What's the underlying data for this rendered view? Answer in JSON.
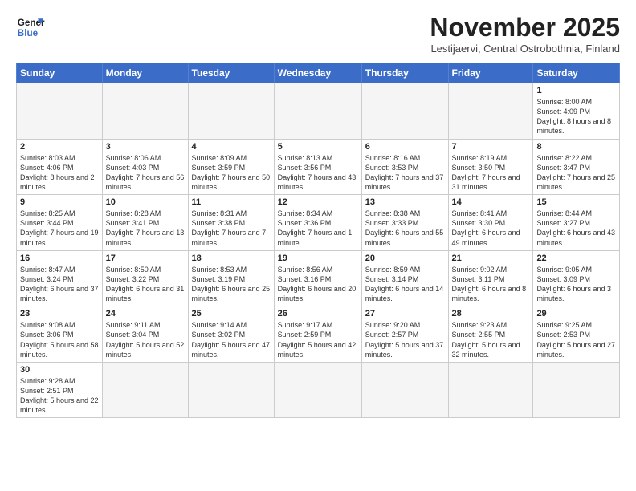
{
  "logo": {
    "line1": "General",
    "line2": "Blue"
  },
  "title": "November 2025",
  "subtitle": "Lestijaervi, Central Ostrobothnia, Finland",
  "weekdays": [
    "Sunday",
    "Monday",
    "Tuesday",
    "Wednesday",
    "Thursday",
    "Friday",
    "Saturday"
  ],
  "weeks": [
    [
      {
        "day": "",
        "info": ""
      },
      {
        "day": "",
        "info": ""
      },
      {
        "day": "",
        "info": ""
      },
      {
        "day": "",
        "info": ""
      },
      {
        "day": "",
        "info": ""
      },
      {
        "day": "",
        "info": ""
      },
      {
        "day": "1",
        "info": "Sunrise: 8:00 AM\nSunset: 4:09 PM\nDaylight: 8 hours\nand 8 minutes."
      }
    ],
    [
      {
        "day": "2",
        "info": "Sunrise: 8:03 AM\nSunset: 4:06 PM\nDaylight: 8 hours\nand 2 minutes."
      },
      {
        "day": "3",
        "info": "Sunrise: 8:06 AM\nSunset: 4:03 PM\nDaylight: 7 hours\nand 56 minutes."
      },
      {
        "day": "4",
        "info": "Sunrise: 8:09 AM\nSunset: 3:59 PM\nDaylight: 7 hours\nand 50 minutes."
      },
      {
        "day": "5",
        "info": "Sunrise: 8:13 AM\nSunset: 3:56 PM\nDaylight: 7 hours\nand 43 minutes."
      },
      {
        "day": "6",
        "info": "Sunrise: 8:16 AM\nSunset: 3:53 PM\nDaylight: 7 hours\nand 37 minutes."
      },
      {
        "day": "7",
        "info": "Sunrise: 8:19 AM\nSunset: 3:50 PM\nDaylight: 7 hours\nand 31 minutes."
      },
      {
        "day": "8",
        "info": "Sunrise: 8:22 AM\nSunset: 3:47 PM\nDaylight: 7 hours\nand 25 minutes."
      }
    ],
    [
      {
        "day": "9",
        "info": "Sunrise: 8:25 AM\nSunset: 3:44 PM\nDaylight: 7 hours\nand 19 minutes."
      },
      {
        "day": "10",
        "info": "Sunrise: 8:28 AM\nSunset: 3:41 PM\nDaylight: 7 hours\nand 13 minutes."
      },
      {
        "day": "11",
        "info": "Sunrise: 8:31 AM\nSunset: 3:38 PM\nDaylight: 7 hours\nand 7 minutes."
      },
      {
        "day": "12",
        "info": "Sunrise: 8:34 AM\nSunset: 3:36 PM\nDaylight: 7 hours\nand 1 minute."
      },
      {
        "day": "13",
        "info": "Sunrise: 8:38 AM\nSunset: 3:33 PM\nDaylight: 6 hours\nand 55 minutes."
      },
      {
        "day": "14",
        "info": "Sunrise: 8:41 AM\nSunset: 3:30 PM\nDaylight: 6 hours\nand 49 minutes."
      },
      {
        "day": "15",
        "info": "Sunrise: 8:44 AM\nSunset: 3:27 PM\nDaylight: 6 hours\nand 43 minutes."
      }
    ],
    [
      {
        "day": "16",
        "info": "Sunrise: 8:47 AM\nSunset: 3:24 PM\nDaylight: 6 hours\nand 37 minutes."
      },
      {
        "day": "17",
        "info": "Sunrise: 8:50 AM\nSunset: 3:22 PM\nDaylight: 6 hours\nand 31 minutes."
      },
      {
        "day": "18",
        "info": "Sunrise: 8:53 AM\nSunset: 3:19 PM\nDaylight: 6 hours\nand 25 minutes."
      },
      {
        "day": "19",
        "info": "Sunrise: 8:56 AM\nSunset: 3:16 PM\nDaylight: 6 hours\nand 20 minutes."
      },
      {
        "day": "20",
        "info": "Sunrise: 8:59 AM\nSunset: 3:14 PM\nDaylight: 6 hours\nand 14 minutes."
      },
      {
        "day": "21",
        "info": "Sunrise: 9:02 AM\nSunset: 3:11 PM\nDaylight: 6 hours\nand 8 minutes."
      },
      {
        "day": "22",
        "info": "Sunrise: 9:05 AM\nSunset: 3:09 PM\nDaylight: 6 hours\nand 3 minutes."
      }
    ],
    [
      {
        "day": "23",
        "info": "Sunrise: 9:08 AM\nSunset: 3:06 PM\nDaylight: 5 hours\nand 58 minutes."
      },
      {
        "day": "24",
        "info": "Sunrise: 9:11 AM\nSunset: 3:04 PM\nDaylight: 5 hours\nand 52 minutes."
      },
      {
        "day": "25",
        "info": "Sunrise: 9:14 AM\nSunset: 3:02 PM\nDaylight: 5 hours\nand 47 minutes."
      },
      {
        "day": "26",
        "info": "Sunrise: 9:17 AM\nSunset: 2:59 PM\nDaylight: 5 hours\nand 42 minutes."
      },
      {
        "day": "27",
        "info": "Sunrise: 9:20 AM\nSunset: 2:57 PM\nDaylight: 5 hours\nand 37 minutes."
      },
      {
        "day": "28",
        "info": "Sunrise: 9:23 AM\nSunset: 2:55 PM\nDaylight: 5 hours\nand 32 minutes."
      },
      {
        "day": "29",
        "info": "Sunrise: 9:25 AM\nSunset: 2:53 PM\nDaylight: 5 hours\nand 27 minutes."
      }
    ],
    [
      {
        "day": "30",
        "info": "Sunrise: 9:28 AM\nSunset: 2:51 PM\nDaylight: 5 hours\nand 22 minutes."
      },
      {
        "day": "",
        "info": ""
      },
      {
        "day": "",
        "info": ""
      },
      {
        "day": "",
        "info": ""
      },
      {
        "day": "",
        "info": ""
      },
      {
        "day": "",
        "info": ""
      },
      {
        "day": "",
        "info": ""
      }
    ]
  ]
}
